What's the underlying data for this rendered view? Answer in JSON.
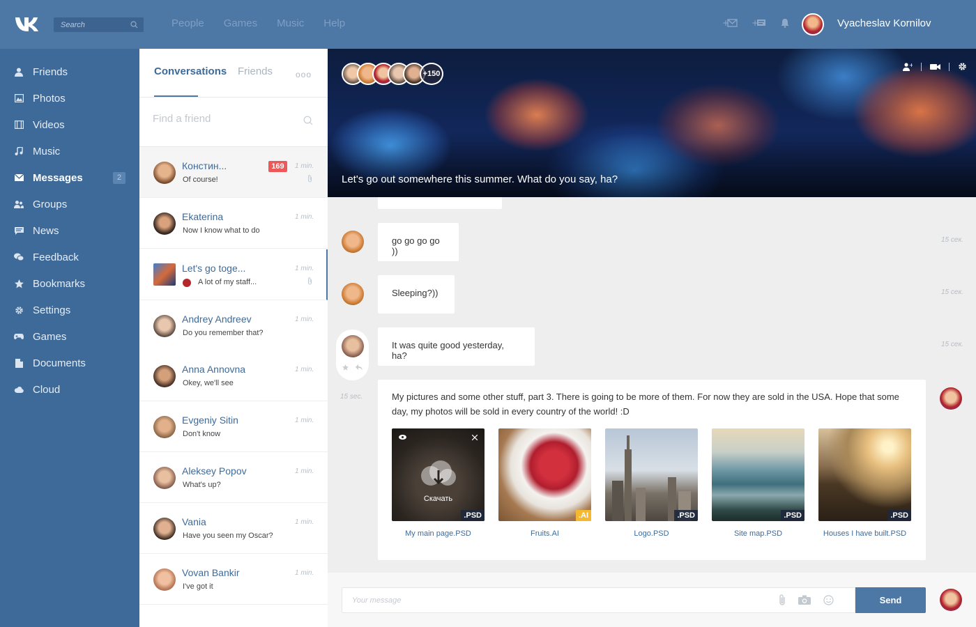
{
  "topbar": {
    "search_placeholder": "Search",
    "nav": [
      "People",
      "Games",
      "Music",
      "Help"
    ],
    "user_name": "Vyacheslav Kornilov"
  },
  "sidebar": {
    "items": [
      {
        "label": "Friends",
        "icon": "person-icon"
      },
      {
        "label": "Photos",
        "icon": "photo-icon"
      },
      {
        "label": "Videos",
        "icon": "film-icon"
      },
      {
        "label": "Music",
        "icon": "music-note-icon"
      },
      {
        "label": "Messages",
        "icon": "envelope-icon",
        "badge": "2",
        "active": true
      },
      {
        "label": "Groups",
        "icon": "group-icon"
      },
      {
        "label": "News",
        "icon": "news-icon"
      },
      {
        "label": "Feedback",
        "icon": "chat-bubbles-icon"
      },
      {
        "label": "Bookmarks",
        "icon": "star-icon"
      },
      {
        "label": "Settings",
        "icon": "gear-icon"
      },
      {
        "label": "Games",
        "icon": "gamepad-icon"
      },
      {
        "label": "Documents",
        "icon": "document-icon"
      },
      {
        "label": "Cloud",
        "icon": "cloud-icon"
      }
    ]
  },
  "conversations": {
    "tab_conversations": "Conversations",
    "tab_friends": "Friends",
    "more": "ooo",
    "find_placeholder": "Find a friend",
    "items": [
      {
        "name": "Констин...",
        "message": "Of course!",
        "time": "1 min.",
        "badge": "169",
        "attachment": true
      },
      {
        "name": "Ekaterina",
        "message": "Now I know what to do",
        "time": "1 min."
      },
      {
        "name": "Let's go toge...",
        "message": "A lot of my staff...",
        "time": "1 min.",
        "attachment": true
      },
      {
        "name": "Andrey Andreev",
        "message": "Do you remember that?",
        "time": "1 min."
      },
      {
        "name": "Anna Annovna",
        "message": "Okey, we'll see",
        "time": "1 min."
      },
      {
        "name": "Evgeniy Sitin",
        "message": "Don't know",
        "time": "1 min."
      },
      {
        "name": "Aleksey Popov",
        "message": "What's up?",
        "time": "1 min."
      },
      {
        "name": "Vania",
        "message": "Have you seen my Oscar?",
        "time": "1 min."
      },
      {
        "name": "Vovan Bankir",
        "message": "I've got it",
        "time": "1 min."
      }
    ]
  },
  "chat": {
    "caption": "Let's go out somewhere this summer. What do you say, ha?",
    "members_more": "+150",
    "messages": [
      {
        "text": "go go go go ))",
        "time": "15 сек."
      },
      {
        "text": "Sleeping?))",
        "time": "15 сек."
      },
      {
        "text": "It was quite good yesterday, ha?",
        "time": "15 сек."
      },
      {
        "text": "My pictures and some other stuff, part 3. There is going to be more of them. For now they are sold in the USA. Hope that some day, my photos will be sold in every country of the world! :D",
        "time": "15 sec."
      }
    ],
    "attachments": [
      {
        "name": "My main page.PSD",
        "ext": ".PSD",
        "overlay": "Скачать"
      },
      {
        "name": "Fruits.AI",
        "ext": ".AI"
      },
      {
        "name": "Logo.PSD",
        "ext": ".PSD"
      },
      {
        "name": "Site map.PSD",
        "ext": ".PSD"
      },
      {
        "name": "Houses I have built.PSD",
        "ext": ".PSD"
      }
    ]
  },
  "composer": {
    "placeholder": "Your message",
    "send": "Send"
  },
  "colors": {
    "topbar": "#4d77a5",
    "sidebar": "#3e6a99",
    "accent": "#4d77a5",
    "badge": "#eb5958",
    "ai_badge": "#f5b82e"
  }
}
